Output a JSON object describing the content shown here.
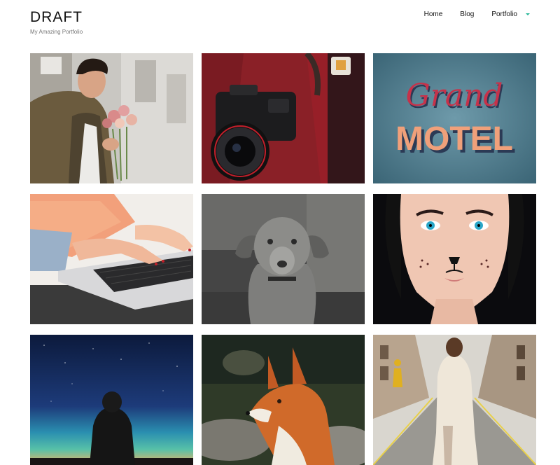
{
  "site": {
    "title": "DRAFT",
    "tagline": "My Amazing Portfolio"
  },
  "nav": {
    "items": [
      {
        "label": "Home"
      },
      {
        "label": "Blog"
      },
      {
        "label": "Portfolio",
        "has_dropdown": true
      }
    ],
    "accent_color": "#2ab89a"
  },
  "gallery": {
    "tiles": [
      {
        "subject": "man-with-flowers"
      },
      {
        "subject": "camera"
      },
      {
        "subject": "grand-motel-sign",
        "sign_line1": "Grand",
        "sign_line2": "MOTEL"
      },
      {
        "subject": "laptop-typing"
      },
      {
        "subject": "puppy"
      },
      {
        "subject": "woman-cat-makeup"
      },
      {
        "subject": "aurora-night-sky"
      },
      {
        "subject": "fox"
      },
      {
        "subject": "woman-street"
      }
    ]
  }
}
